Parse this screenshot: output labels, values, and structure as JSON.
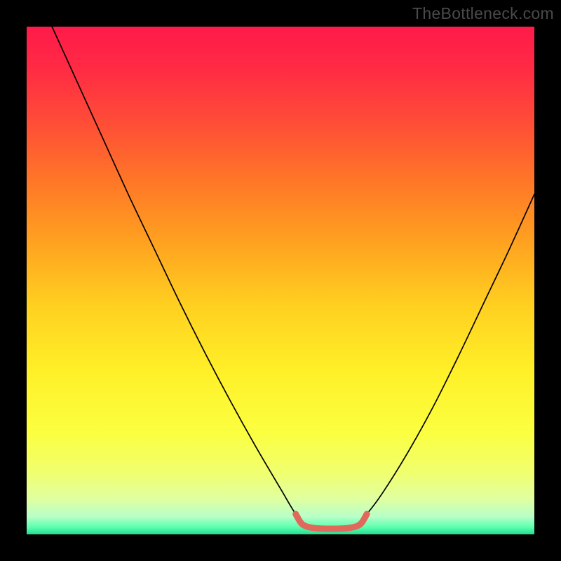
{
  "watermark": "TheBottleneck.com",
  "gradient": {
    "stops": [
      {
        "offset": 0.0,
        "color": "#ff1a4a"
      },
      {
        "offset": 0.08,
        "color": "#ff2a44"
      },
      {
        "offset": 0.18,
        "color": "#ff4a38"
      },
      {
        "offset": 0.3,
        "color": "#ff7528"
      },
      {
        "offset": 0.42,
        "color": "#ffa020"
      },
      {
        "offset": 0.55,
        "color": "#ffd020"
      },
      {
        "offset": 0.68,
        "color": "#fff028"
      },
      {
        "offset": 0.8,
        "color": "#fbff40"
      },
      {
        "offset": 0.88,
        "color": "#f0ff70"
      },
      {
        "offset": 0.93,
        "color": "#e0ffa0"
      },
      {
        "offset": 0.965,
        "color": "#b8ffc8"
      },
      {
        "offset": 0.985,
        "color": "#60ffb0"
      },
      {
        "offset": 1.0,
        "color": "#20e090"
      }
    ]
  },
  "chart_data": {
    "type": "line",
    "title": "",
    "xlabel": "",
    "ylabel": "",
    "xlim": [
      0,
      100
    ],
    "ylim": [
      0,
      100
    ],
    "series": [
      {
        "name": "curve-left",
        "x": [
          5,
          10,
          15,
          20,
          25,
          30,
          35,
          40,
          45,
          50,
          53,
          55
        ],
        "y": [
          100,
          89,
          78,
          67,
          56.5,
          46,
          36,
          26.5,
          17.5,
          9,
          4,
          2
        ],
        "stroke": "#000000",
        "width": 1.7
      },
      {
        "name": "curve-right",
        "x": [
          65,
          67,
          70,
          75,
          80,
          85,
          90,
          95,
          100
        ],
        "y": [
          2,
          4,
          8,
          16,
          25,
          35,
          45.5,
          56,
          67
        ],
        "stroke": "#000000",
        "width": 1.7
      },
      {
        "name": "base-highlight",
        "x": [
          53,
          54,
          55,
          57,
          60,
          63,
          65,
          66,
          67
        ],
        "y": [
          4,
          2.3,
          1.6,
          1.2,
          1.1,
          1.2,
          1.6,
          2.3,
          4
        ],
        "stroke": "#e0695c",
        "width": 9
      }
    ]
  }
}
